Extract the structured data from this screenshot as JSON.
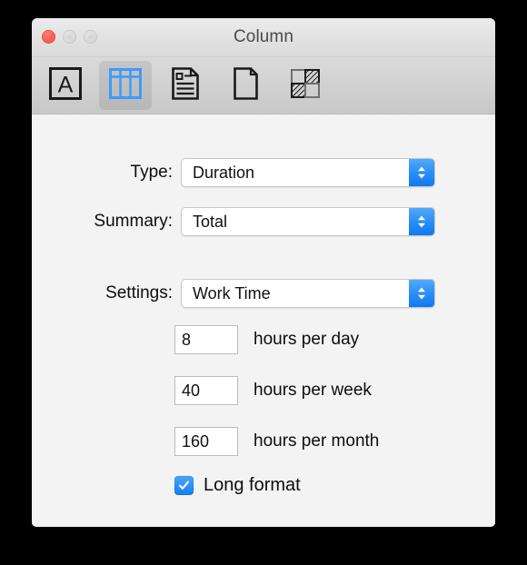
{
  "window": {
    "title": "Column",
    "traffic_lights": [
      {
        "name": "close",
        "color": "#fd5e55",
        "enabled": true
      },
      {
        "name": "minimize",
        "color": "#d9d9d9",
        "enabled": false
      },
      {
        "name": "zoom",
        "color": "#d9d9d9",
        "enabled": false
      }
    ]
  },
  "toolbar": {
    "items": [
      {
        "icon": "letter-a-box-icon",
        "selected": false
      },
      {
        "icon": "table-columns-icon",
        "selected": true
      },
      {
        "icon": "document-lines-icon",
        "selected": false
      },
      {
        "icon": "blank-page-icon",
        "selected": false
      },
      {
        "icon": "checkerboard-pattern-icon",
        "selected": false
      }
    ],
    "selected_index": 1,
    "accent_color": "#3b9bfb"
  },
  "form": {
    "type": {
      "label": "Type:",
      "value": "Duration"
    },
    "summary": {
      "label": "Summary:",
      "value": "Total"
    },
    "settings": {
      "label": "Settings:",
      "value": "Work Time"
    },
    "fields": [
      {
        "value": "8",
        "unit": "hours per day"
      },
      {
        "value": "40",
        "unit": "hours per week"
      },
      {
        "value": "160",
        "unit": "hours per month"
      }
    ],
    "long_format": {
      "label": "Long format",
      "checked": true
    }
  }
}
